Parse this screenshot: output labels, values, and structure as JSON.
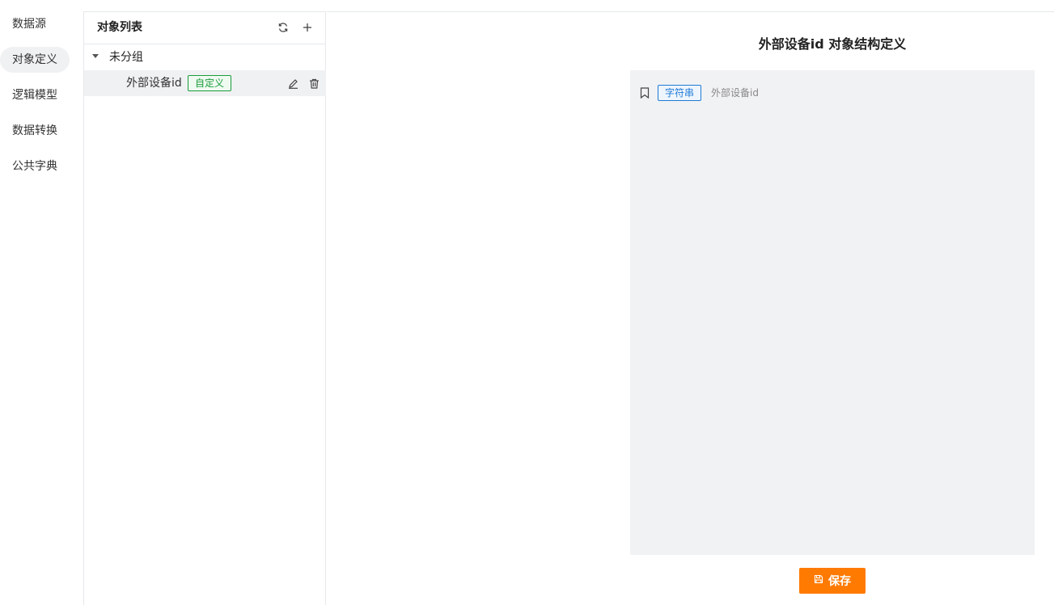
{
  "nav": {
    "items": [
      {
        "label": "数据源",
        "active": false
      },
      {
        "label": "对象定义",
        "active": true
      },
      {
        "label": "逻辑模型",
        "active": false
      },
      {
        "label": "数据转换",
        "active": false
      },
      {
        "label": "公共字典",
        "active": false
      }
    ]
  },
  "object_list": {
    "title": "对象列表",
    "icons": {
      "refresh": "refresh-icon",
      "add": "plus-icon"
    },
    "group": {
      "label": "未分组",
      "expanded": true
    },
    "items": [
      {
        "label": "外部设备id",
        "tag": "自定义",
        "selected": true
      }
    ]
  },
  "main": {
    "title": "外部设备id 对象结构定义",
    "fields": [
      {
        "type_tag": "字符串",
        "name": "外部设备id"
      }
    ],
    "save_label": "保存"
  },
  "colors": {
    "accent": "#ff7a00",
    "custom_tag": "#1a9c3b",
    "string_tag": "#1f7ad6",
    "selected_bg": "#f0f1f3"
  }
}
